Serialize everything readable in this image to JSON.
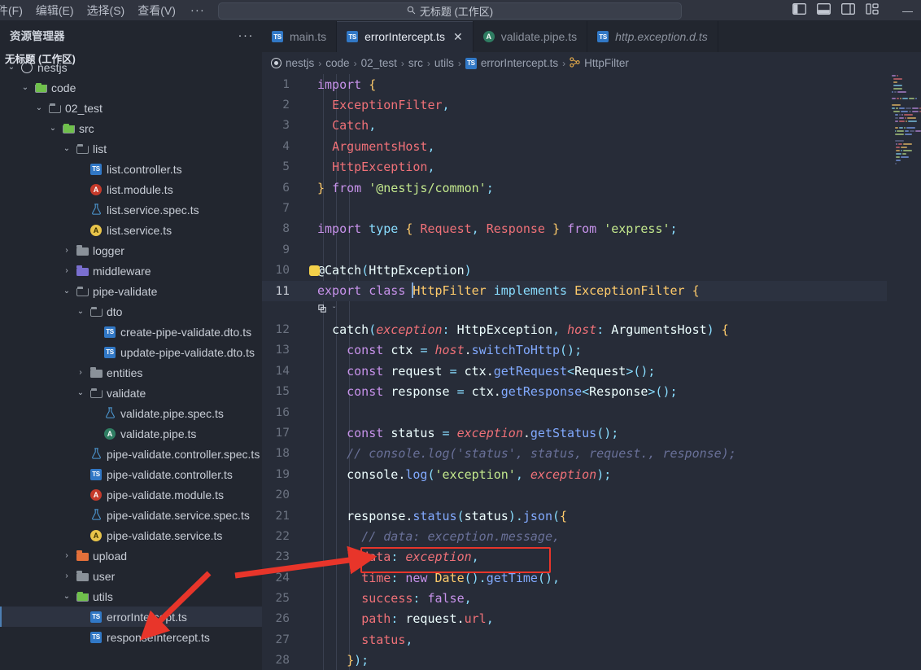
{
  "titlebar": {
    "menu": [
      {
        "label": "件(F)",
        "name": "menu-file"
      },
      {
        "label": "编辑(E)",
        "name": "menu-edit"
      },
      {
        "label": "选择(S)",
        "name": "menu-selection"
      },
      {
        "label": "查看(V)",
        "name": "menu-view"
      }
    ],
    "more_label": "···",
    "back_label": "←",
    "forward_label": "→",
    "command_center": {
      "search_icon": "search-icon",
      "text": "无标题 (工作区)"
    },
    "layout_icons": [
      "toggle-primary-sidebar-icon",
      "toggle-panel-icon",
      "toggle-secondary-sidebar-icon",
      "customize-layout-icon"
    ],
    "window_controls": {
      "minimize": "—",
      "maximize": "□",
      "close": "✕"
    }
  },
  "sidebar": {
    "title": "资源管理器",
    "actions_label": "···",
    "section_title": "无标题 (工作区)",
    "tree": [
      {
        "label": "nestjs",
        "depth": 0,
        "twisty": "chevron-down",
        "icon": "nest-circle",
        "selected": false
      },
      {
        "label": "code",
        "depth": 1,
        "twisty": "chevron-down",
        "icon": "folder-green-open",
        "selected": false
      },
      {
        "label": "02_test",
        "depth": 2,
        "twisty": "chevron-down",
        "icon": "folder-open",
        "selected": false
      },
      {
        "label": "src",
        "depth": 3,
        "twisty": "chevron-down",
        "icon": "folder-green-open",
        "selected": false
      },
      {
        "label": "list",
        "depth": 4,
        "twisty": "chevron-down",
        "icon": "folder-open",
        "selected": false
      },
      {
        "label": "list.controller.ts",
        "depth": 5,
        "twisty": "none",
        "icon": "ts-file",
        "selected": false
      },
      {
        "label": "list.module.ts",
        "depth": 5,
        "twisty": "none",
        "icon": "ng-red",
        "selected": false
      },
      {
        "label": "list.service.spec.ts",
        "depth": 5,
        "twisty": "none",
        "icon": "flask",
        "selected": false
      },
      {
        "label": "list.service.ts",
        "depth": 5,
        "twisty": "none",
        "icon": "ng-yellow",
        "selected": false
      },
      {
        "label": "logger",
        "depth": 4,
        "twisty": "chevron-right",
        "icon": "folder",
        "selected": false
      },
      {
        "label": "middleware",
        "depth": 4,
        "twisty": "chevron-right",
        "icon": "folder-purple",
        "selected": false
      },
      {
        "label": "pipe-validate",
        "depth": 4,
        "twisty": "chevron-down",
        "icon": "folder-open",
        "selected": false
      },
      {
        "label": "dto",
        "depth": 5,
        "twisty": "chevron-down",
        "icon": "folder-open",
        "selected": false
      },
      {
        "label": "create-pipe-validate.dto.ts",
        "depth": 6,
        "twisty": "none",
        "icon": "ts-file",
        "selected": false
      },
      {
        "label": "update-pipe-validate.dto.ts",
        "depth": 6,
        "twisty": "none",
        "icon": "ts-file",
        "selected": false
      },
      {
        "label": "entities",
        "depth": 5,
        "twisty": "chevron-right",
        "icon": "folder",
        "selected": false
      },
      {
        "label": "validate",
        "depth": 5,
        "twisty": "chevron-down",
        "icon": "folder-open",
        "selected": false
      },
      {
        "label": "validate.pipe.spec.ts",
        "depth": 6,
        "twisty": "none",
        "icon": "flask",
        "selected": false
      },
      {
        "label": "validate.pipe.ts",
        "depth": 6,
        "twisty": "none",
        "icon": "ng-green",
        "selected": false
      },
      {
        "label": "pipe-validate.controller.spec.ts",
        "depth": 5,
        "twisty": "none",
        "icon": "flask",
        "selected": false
      },
      {
        "label": "pipe-validate.controller.ts",
        "depth": 5,
        "twisty": "none",
        "icon": "ts-file",
        "selected": false
      },
      {
        "label": "pipe-validate.module.ts",
        "depth": 5,
        "twisty": "none",
        "icon": "ng-red",
        "selected": false
      },
      {
        "label": "pipe-validate.service.spec.ts",
        "depth": 5,
        "twisty": "none",
        "icon": "flask",
        "selected": false
      },
      {
        "label": "pipe-validate.service.ts",
        "depth": 5,
        "twisty": "none",
        "icon": "ng-yellow",
        "selected": false
      },
      {
        "label": "upload",
        "depth": 4,
        "twisty": "chevron-right",
        "icon": "folder-orange",
        "selected": false
      },
      {
        "label": "user",
        "depth": 4,
        "twisty": "chevron-right",
        "icon": "folder",
        "selected": false
      },
      {
        "label": "utils",
        "depth": 4,
        "twisty": "chevron-down",
        "icon": "folder-green-open",
        "selected": false
      },
      {
        "label": "errorIntercept.ts",
        "depth": 5,
        "twisty": "none",
        "icon": "ts-file",
        "selected": true
      },
      {
        "label": "responseIntercept.ts",
        "depth": 5,
        "twisty": "none",
        "icon": "ts-file",
        "selected": false
      }
    ]
  },
  "editor": {
    "tabs": [
      {
        "label": "main.ts",
        "icon": "ts-file",
        "active": false,
        "preview": false,
        "closable": false
      },
      {
        "label": "errorIntercept.ts",
        "icon": "ts-file",
        "active": true,
        "preview": false,
        "closable": true,
        "close_label": "✕"
      },
      {
        "label": "validate.pipe.ts",
        "icon": "ng-green",
        "active": false,
        "preview": false,
        "closable": false
      },
      {
        "label": "http.exception.d.ts",
        "icon": "ts-file",
        "active": false,
        "preview": true,
        "closable": false
      }
    ],
    "breadcrumbs": [
      {
        "label": "nestjs",
        "icon": "nest-circle"
      },
      {
        "label": "code"
      },
      {
        "label": "02_test"
      },
      {
        "label": "src"
      },
      {
        "label": "utils"
      },
      {
        "label": "errorIntercept.ts",
        "icon": "ts-file"
      },
      {
        "label": "HttpFilter",
        "icon": "interface-icon"
      }
    ],
    "breadcrumb_separator": "›",
    "codelens": {
      "glyph": "references-icon",
      "chevron": "ˇ"
    },
    "lines": [
      {
        "n": "1"
      },
      {
        "n": "2"
      },
      {
        "n": "3"
      },
      {
        "n": "4"
      },
      {
        "n": "5"
      },
      {
        "n": "6"
      },
      {
        "n": "7"
      },
      {
        "n": "8"
      },
      {
        "n": "9"
      },
      {
        "n": "10"
      },
      {
        "n": "11",
        "active": true
      },
      {
        "n": "12"
      },
      {
        "n": "13"
      },
      {
        "n": "14"
      },
      {
        "n": "15"
      },
      {
        "n": "16"
      },
      {
        "n": "17"
      },
      {
        "n": "18"
      },
      {
        "n": "19"
      },
      {
        "n": "20"
      },
      {
        "n": "21"
      },
      {
        "n": "22"
      },
      {
        "n": "23"
      },
      {
        "n": "24"
      },
      {
        "n": "25"
      },
      {
        "n": "26"
      },
      {
        "n": "27"
      },
      {
        "n": "28"
      }
    ],
    "source_text": [
      "import {",
      "  ExceptionFilter,",
      "  Catch,",
      "  ArgumentsHost,",
      "  HttpException,",
      "} from '@nestjs/common';",
      "",
      "import type { Request, Response } from 'express';",
      "",
      "@Catch(HttpException)",
      "export class HttpFilter implements ExceptionFilter {",
      "  catch(exception: HttpException, host: ArgumentsHost) {",
      "    const ctx = host.switchToHttp();",
      "    const request = ctx.getRequest<Request>();",
      "    const response = ctx.getResponse<Response>();",
      "",
      "    const status = exception.getStatus();",
      "    // console.log('status', status, request., response);",
      "    console.log('exception', exception);",
      "",
      "    response.status(status).json({",
      "      // data: exception.message,",
      "      data: exception,",
      "      time: new Date().getTime(),",
      "      success: false,",
      "      path: request.url,",
      "      status,",
      "    });"
    ]
  },
  "annotations": {
    "highlight_box": {
      "target_line": "23",
      "color": "#e8352a"
    },
    "arrows": [
      {
        "name": "arrow-to-code-line",
        "color": "#e8352a"
      },
      {
        "name": "arrow-to-sidebar-file",
        "color": "#e8352a"
      }
    ]
  },
  "colors": {
    "accent": "#4d7fb3",
    "annotation": "#e8352a",
    "editor_bg": "#272c38",
    "sidebar_bg": "#22262f",
    "titlebar_bg": "#30343f"
  }
}
